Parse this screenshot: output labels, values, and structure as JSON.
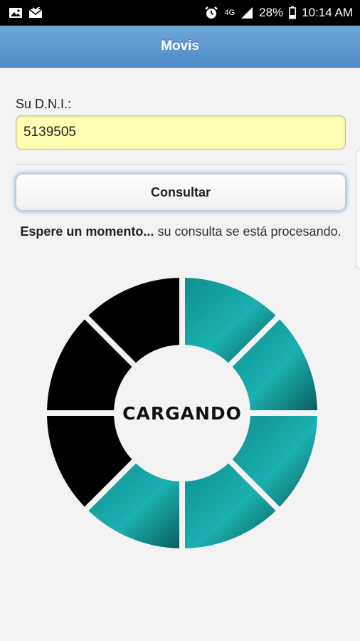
{
  "status_bar": {
    "battery": "28%",
    "time": "10:14 AM",
    "network": "4G",
    "icons": [
      "image-icon",
      "mail-icon",
      "alarm-icon",
      "signal-icon",
      "battery-icon"
    ]
  },
  "header": {
    "title": "Movis"
  },
  "form": {
    "dni_label": "Su D.N.I.:",
    "dni_value": "5139505",
    "consult_button": "Consultar"
  },
  "message": {
    "bold": "Espere un momento...",
    "rest": " su consulta se está procesando."
  },
  "loader": {
    "text": "CARGANDO",
    "segments": 8,
    "active_segments": 5,
    "colors": {
      "active": "#1aa6a6",
      "inactive": "#000000"
    }
  },
  "colors": {
    "header": "#5b97cf",
    "input_bg": "#ffffb3",
    "button_glow": "#9cc2e6"
  }
}
